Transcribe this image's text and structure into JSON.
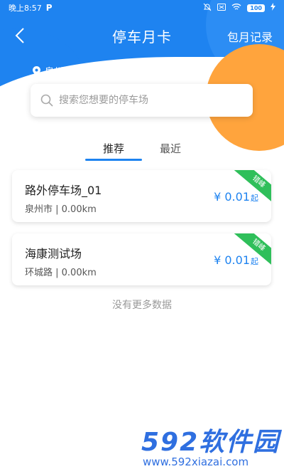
{
  "status_bar": {
    "time": "晚上8:57",
    "app_icon": "P",
    "battery": "100"
  },
  "nav": {
    "back_icon": "chevron-left-icon",
    "title": "停车月卡",
    "record": "包月记录"
  },
  "location": {
    "icon": "location-pin-icon",
    "text": "泉州市丰泽区法坊路"
  },
  "search": {
    "placeholder": "搜索您想要的停车场"
  },
  "tabs": [
    {
      "label": "推荐",
      "active": true
    },
    {
      "label": "最近",
      "active": false
    }
  ],
  "lots": [
    {
      "name": "路外停车场_01",
      "sub": "泉州市 | 0.00km",
      "price": "¥ 0.01",
      "unit": "起",
      "tag": "错峰"
    },
    {
      "name": "海康测试场",
      "sub": "环城路 | 0.00km",
      "price": "¥ 0.01",
      "unit": "起",
      "tag": "错峰"
    }
  ],
  "no_more": "没有更多数据",
  "watermark": {
    "logo_text": "592软件园",
    "url": "www.592xiazai.com"
  },
  "colors": {
    "primary": "#1e83f0",
    "accent_orange": "#ffa43d",
    "tag_green": "#2fbf5a"
  }
}
